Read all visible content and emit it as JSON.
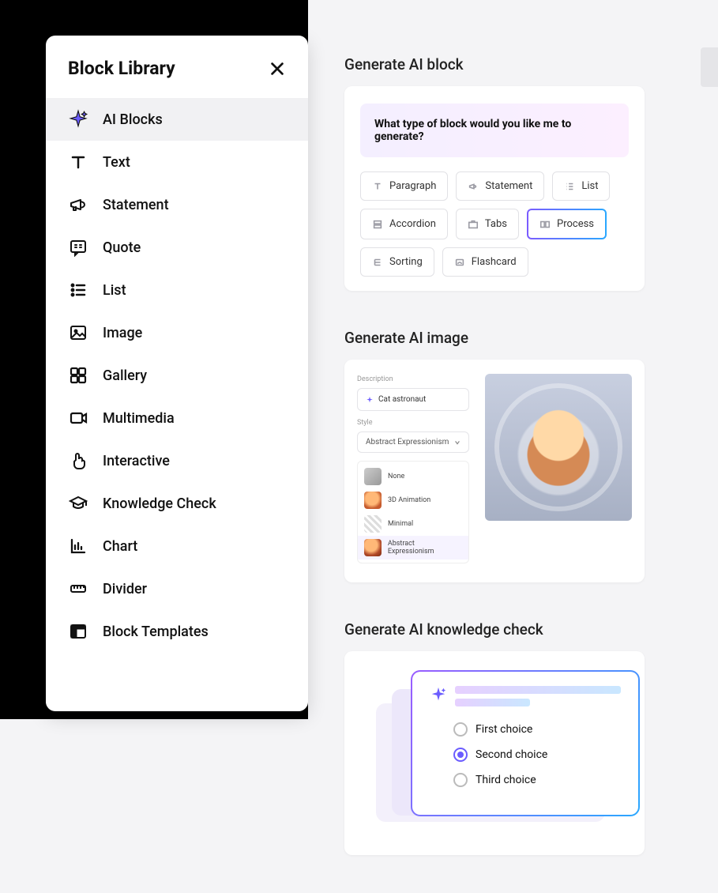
{
  "sidebar": {
    "title": "Block Library",
    "items": [
      {
        "label": "AI Blocks",
        "active": true
      },
      {
        "label": "Text"
      },
      {
        "label": "Statement"
      },
      {
        "label": "Quote"
      },
      {
        "label": "List"
      },
      {
        "label": "Image"
      },
      {
        "label": "Gallery"
      },
      {
        "label": "Multimedia"
      },
      {
        "label": "Interactive"
      },
      {
        "label": "Knowledge Check"
      },
      {
        "label": "Chart"
      },
      {
        "label": "Divider"
      },
      {
        "label": "Block Templates"
      }
    ]
  },
  "ai_block": {
    "section_title": "Generate AI block",
    "prompt": "What type of block would you like me to generate?",
    "chips": [
      {
        "label": "Paragraph"
      },
      {
        "label": "Statement"
      },
      {
        "label": "List"
      },
      {
        "label": "Accordion"
      },
      {
        "label": "Tabs"
      },
      {
        "label": "Process",
        "selected": true
      },
      {
        "label": "Sorting"
      },
      {
        "label": "Flashcard"
      }
    ]
  },
  "ai_image": {
    "section_title": "Generate AI image",
    "description_label": "Description",
    "description_value": "Cat astronaut",
    "style_label": "Style",
    "style_selected": "Abstract Expressionism",
    "style_options": [
      {
        "label": "None"
      },
      {
        "label": "3D Animation"
      },
      {
        "label": "Minimal"
      },
      {
        "label": "Abstract Expressionism",
        "selected": true
      }
    ]
  },
  "ai_kc": {
    "section_title": "Generate AI knowledge check",
    "choices": [
      {
        "label": "First choice"
      },
      {
        "label": "Second choice",
        "selected": true
      },
      {
        "label": "Third choice"
      }
    ]
  }
}
